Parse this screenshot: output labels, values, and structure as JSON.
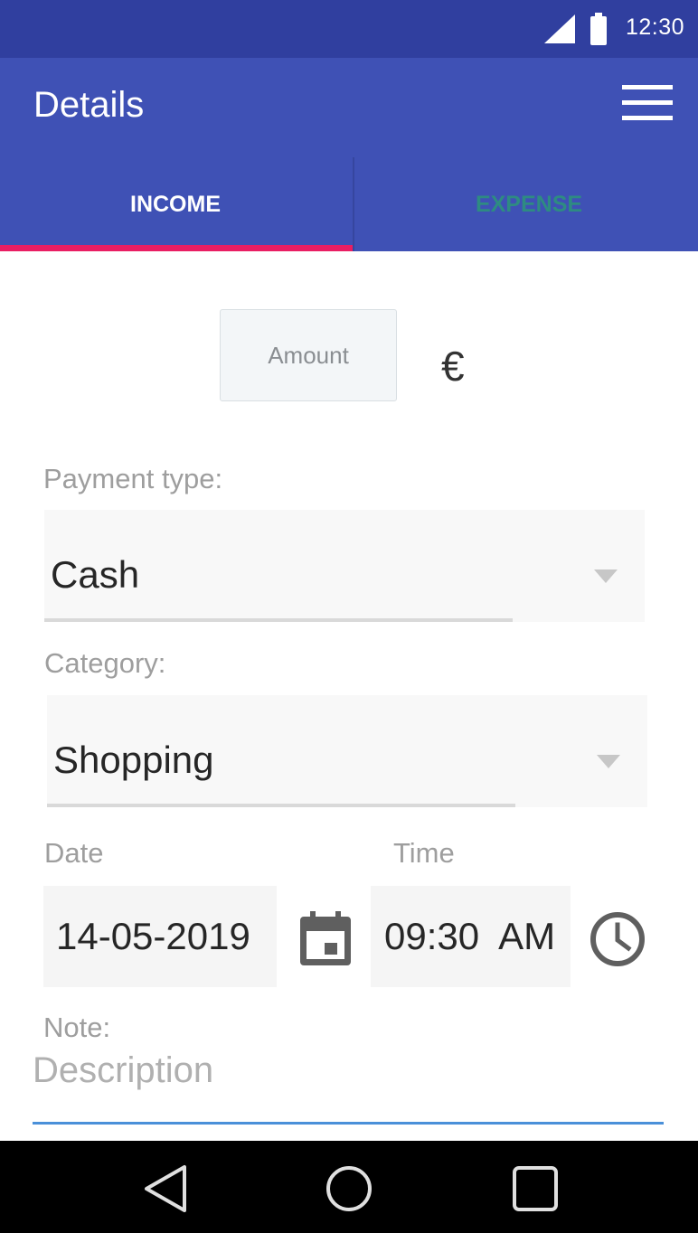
{
  "status_bar": {
    "time": "12:30",
    "icons": [
      "signal-icon",
      "battery-icon"
    ]
  },
  "app_bar": {
    "title": "Details",
    "menu_icon": "hamburger-menu-icon"
  },
  "tabs": [
    {
      "label": "INCOME",
      "selected": true
    },
    {
      "label": "EXPENSE",
      "selected": false
    }
  ],
  "amount": {
    "placeholder": "Amount",
    "value": "",
    "currency": "€"
  },
  "payment_type": {
    "label": "Payment type:",
    "selected": "Cash"
  },
  "category": {
    "label": "Category:",
    "selected": "Shopping"
  },
  "date": {
    "label": "Date",
    "value": "14-05-2019",
    "icon": "calendar-icon"
  },
  "time": {
    "label": "Time",
    "value": "09:30  AM",
    "icon": "clock-icon"
  },
  "note": {
    "label": "Note:",
    "placeholder": "Description",
    "value": ""
  },
  "nav_bar": {
    "icons": [
      "back-icon",
      "home-icon",
      "recents-icon"
    ]
  },
  "colors": {
    "status_bar": "#303f9f",
    "primary": "#3f51b5",
    "tab_indicator": "#e91e63",
    "inactive_tab_text": "#2e8b82",
    "note_underline": "#4a90d9"
  }
}
